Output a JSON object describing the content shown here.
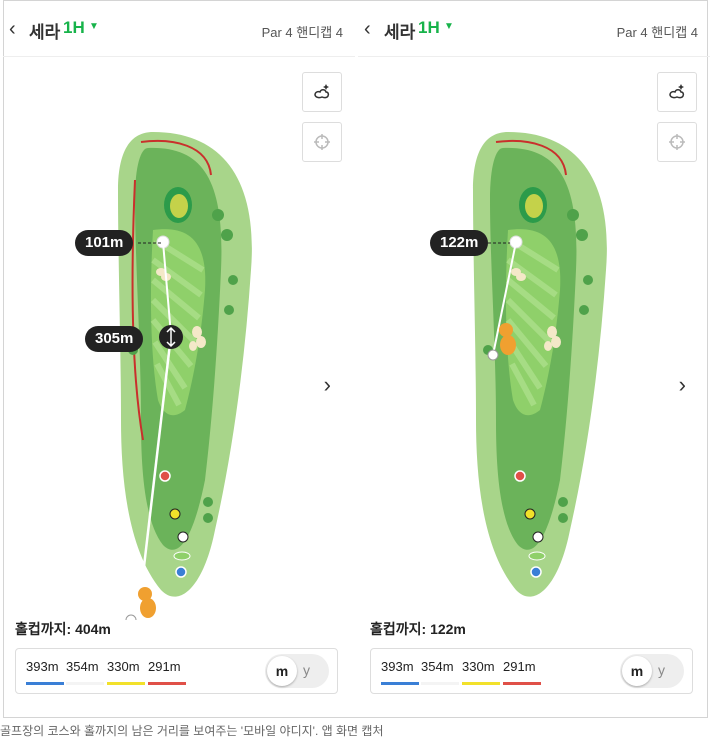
{
  "left": {
    "course": "세라",
    "hole": "1H",
    "par_info": "Par 4 핸디캡 4",
    "tags": [
      "101m",
      "305m"
    ],
    "to_hole_label": "홀컵까지:",
    "to_hole_value": "404m"
  },
  "right": {
    "course": "세라",
    "hole": "1H",
    "par_info": "Par 4 핸디캡 4",
    "tags": [
      "122m"
    ],
    "to_hole_label": "홀컵까지:",
    "to_hole_value": "122m"
  },
  "tees": [
    {
      "distance": "393m",
      "color": "#3a7fd6"
    },
    {
      "distance": "354m",
      "color": "#ffffff"
    },
    {
      "distance": "330m",
      "color": "#f2e12a"
    },
    {
      "distance": "291m",
      "color": "#e05048"
    }
  ],
  "units": {
    "selected": "m",
    "other": "y"
  },
  "icons": [
    "back-chevron-icon",
    "caret-down-icon",
    "flyover-icon",
    "crosshair-icon",
    "chevron-right-icon"
  ],
  "caption": "골프장의 코스와 홀까지의 남은 거리를 보여주는 '모바일 야디지'. 앱 화면 캡처"
}
